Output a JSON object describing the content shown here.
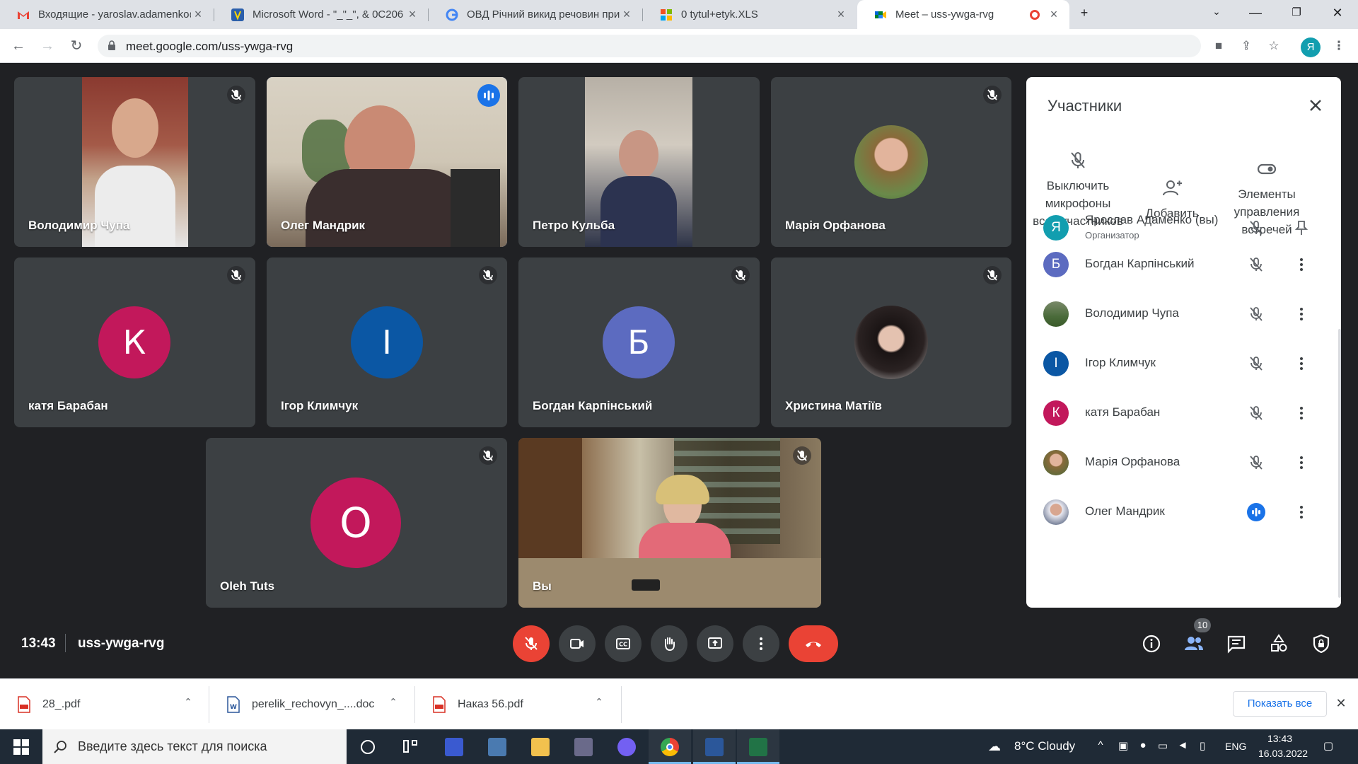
{
  "browser": {
    "tabs": [
      {
        "title": "Входящие - yaroslav.adamenko@",
        "icon": "gmail-icon"
      },
      {
        "title": "Microsoft Word - \"_\"_\", & 0C206",
        "icon": "trident-icon"
      },
      {
        "title": "ОВД Річний викид речовин при",
        "icon": "google-icon"
      },
      {
        "title": "0 tytul+etyk.XLS",
        "icon": "colorful-grid-icon"
      },
      {
        "title": "Meet – uss-ywga-rvg",
        "icon": "meet-icon",
        "active": true
      }
    ],
    "url": "meet.google.com/uss-ywga-rvg",
    "profile_letter": "Я"
  },
  "tiles": [
    {
      "name": "Володимир Чупа",
      "type": "video",
      "muted": true
    },
    {
      "name": "Олег Мандрик",
      "type": "video",
      "speaking": true
    },
    {
      "name": "Петро Кульба",
      "type": "video"
    },
    {
      "name": "Марія Орфанова",
      "type": "photo",
      "muted": true
    },
    {
      "name": "катя Барабан",
      "type": "letter",
      "letter": "К",
      "color": "#c2185b",
      "muted": true
    },
    {
      "name": "Ігор Климчук",
      "type": "letter",
      "letter": "І",
      "color": "#0b57a4",
      "muted": true
    },
    {
      "name": "Богдан Карпінський",
      "type": "letter",
      "letter": "Б",
      "color": "#5c6bc0",
      "muted": true
    },
    {
      "name": "Христина Матіїв",
      "type": "photo",
      "muted": true
    },
    {
      "name": "Oleh Tuts",
      "type": "letter",
      "letter": "O",
      "color": "#c2185b",
      "muted": true
    },
    {
      "name": "Вы",
      "type": "video",
      "muted": true
    }
  ],
  "panel": {
    "title": "Участники",
    "actions": [
      {
        "label": "Выключить микрофоны всех участников",
        "icon": "mic-off-icon"
      },
      {
        "label": "Добавить",
        "icon": "add-person-icon"
      },
      {
        "label": "Элементы управления встречей",
        "icon": "toggle-icon"
      }
    ],
    "participants": [
      {
        "name": "Ярослав Адаменко (вы)",
        "role": "Организатор",
        "letter": "Я",
        "color": "#129eaf",
        "status": "muted",
        "action": "pin"
      },
      {
        "name": "Богдан Карпінський",
        "letter": "Б",
        "color": "#5c6bc0",
        "status": "muted",
        "action": "more"
      },
      {
        "name": "Володимир Чупа",
        "letter": "",
        "color": "#4a6b3a",
        "status": "muted",
        "action": "more"
      },
      {
        "name": "Ігор Климчук",
        "letter": "І",
        "color": "#0b57a4",
        "status": "muted",
        "action": "more"
      },
      {
        "name": "катя Барабан",
        "letter": "К",
        "color": "#c2185b",
        "status": "muted",
        "action": "more"
      },
      {
        "name": "Марія Орфанова",
        "letter": "",
        "color": "#7a6a4a",
        "status": "muted",
        "action": "more"
      },
      {
        "name": "Олег Мандрик",
        "letter": "",
        "color": "#3a4a6a",
        "status": "speaking",
        "action": "more"
      }
    ]
  },
  "controls": {
    "time": "13:43",
    "meeting_code": "uss-ywga-rvg",
    "participant_count": "10"
  },
  "downloads": {
    "items": [
      {
        "name": "28_.pdf",
        "icon": "pdf-icon"
      },
      {
        "name": "perelik_rechovyn_....doc",
        "icon": "word-doc-icon"
      },
      {
        "name": "Наказ 56.pdf",
        "icon": "pdf-icon"
      }
    ],
    "show_all": "Показать все"
  },
  "taskbar": {
    "search_placeholder": "Введите здесь текст для поиска",
    "weather": "8°C  Cloudy",
    "language": "ENG",
    "time": "13:43",
    "date": "16.03.2022"
  },
  "colors": {
    "meet_bg": "#202124",
    "tile_bg": "#3c4043",
    "accent": "#1a73e8",
    "end_call": "#ea4335"
  }
}
